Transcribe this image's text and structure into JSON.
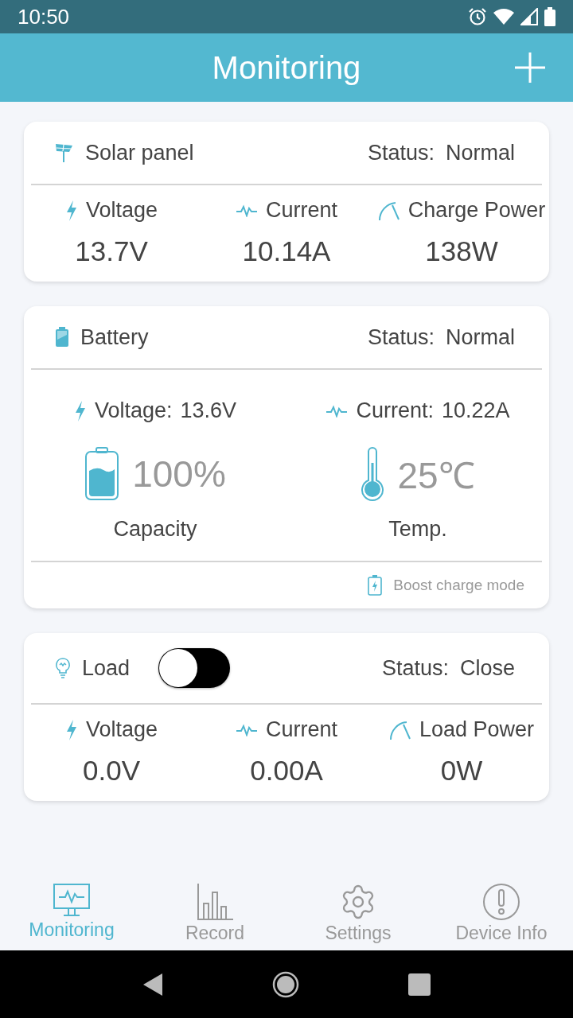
{
  "status_bar": {
    "time": "10:50"
  },
  "header": {
    "title": "Monitoring"
  },
  "solar": {
    "title": "Solar panel",
    "status_label": "Status:",
    "status": "Normal",
    "metrics": [
      {
        "kind": "voltage",
        "label": "Voltage",
        "value": "13.7V"
      },
      {
        "kind": "current",
        "label": "Current",
        "value": "10.14A"
      },
      {
        "kind": "power",
        "label": "Charge Power",
        "value": "138W"
      }
    ]
  },
  "battery": {
    "title": "Battery",
    "status_label": "Status:",
    "status": "Normal",
    "readings": [
      {
        "kind": "voltage",
        "label": "Voltage:",
        "value": "13.6V"
      },
      {
        "kind": "current",
        "label": "Current:",
        "value": "10.22A"
      }
    ],
    "gauges": [
      {
        "kind": "capacity",
        "value": "100%",
        "label": "Capacity"
      },
      {
        "kind": "temperature",
        "value": "25℃",
        "label": "Temp."
      }
    ],
    "mode": "Boost charge mode"
  },
  "load": {
    "title": "Load",
    "on": false,
    "status_label": "Status:",
    "status": "Close",
    "metrics": [
      {
        "kind": "voltage",
        "label": "Voltage",
        "value": "0.0V"
      },
      {
        "kind": "current",
        "label": "Current",
        "value": "0.00A"
      },
      {
        "kind": "power",
        "label": "Load Power",
        "value": "0W"
      }
    ]
  },
  "nav": [
    {
      "kind": "monitoring",
      "label": "Monitoring",
      "selected": true
    },
    {
      "kind": "record",
      "label": "Record",
      "selected": false
    },
    {
      "kind": "settings",
      "label": "Settings",
      "selected": false
    },
    {
      "kind": "info",
      "label": "Device Info",
      "selected": false
    }
  ]
}
